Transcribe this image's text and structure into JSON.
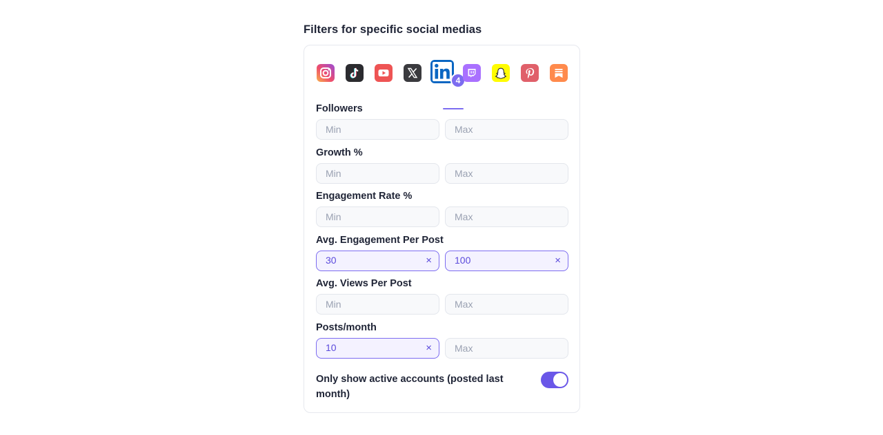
{
  "section": {
    "title": "Filters for specific social medias"
  },
  "platforms": {
    "items": [
      "instagram",
      "tiktok",
      "youtube",
      "x",
      "linkedin",
      "twitch",
      "snapchat",
      "pinterest",
      "substack"
    ],
    "active": "linkedin",
    "active_badge": "4"
  },
  "filters": [
    {
      "label": "Followers",
      "min": "",
      "max": "",
      "min_placeholder": "Min",
      "max_placeholder": "Max"
    },
    {
      "label": "Growth %",
      "min": "",
      "max": "",
      "min_placeholder": "Min",
      "max_placeholder": "Max"
    },
    {
      "label": "Engagement Rate %",
      "min": "",
      "max": "",
      "min_placeholder": "Min",
      "max_placeholder": "Max"
    },
    {
      "label": "Avg. Engagement Per Post",
      "min": "30",
      "max": "100",
      "min_placeholder": "Min",
      "max_placeholder": "Max"
    },
    {
      "label": "Avg. Views Per Post",
      "min": "",
      "max": "",
      "min_placeholder": "Min",
      "max_placeholder": "Max"
    },
    {
      "label": "Posts/month",
      "min": "10",
      "max": "",
      "min_placeholder": "Min",
      "max_placeholder": "Max"
    }
  ],
  "clear_glyph": "×",
  "active_toggle": {
    "label": "Only show active accounts (posted last month)",
    "enabled": true
  },
  "colors": {
    "accent": "#7c6cf0",
    "toggle_on": "#6a57e8"
  }
}
